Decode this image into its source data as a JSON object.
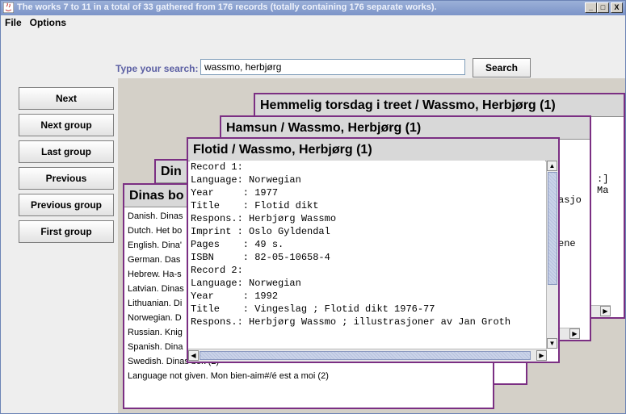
{
  "window": {
    "title": "The works 7 to 11 in a total of 33 gathered from 176 records (totally containing 176 separate works).",
    "minimize": "_",
    "maximize": "□",
    "close": "X"
  },
  "menu": {
    "file": "File",
    "options": "Options"
  },
  "search": {
    "label": "Type your search:",
    "value": "wassmo, herbjørg",
    "button": "Search"
  },
  "nav": {
    "next": "Next",
    "next_group": "Next group",
    "last_group": "Last group",
    "previous": "Previous",
    "previous_group": "Previous group",
    "first_group": "First group"
  },
  "cards": {
    "hemmelig": {
      "title": "Hemmelig torsdag i treet / Wassmo, Herbjørg (1)",
      "fragment": ":] Ma"
    },
    "hamsun": {
      "title": "Hamsun / Wassmo, Herbjørg (1)",
      "fragment1": "asjo",
      "fragment2": "ene"
    },
    "din": {
      "title": "Din"
    },
    "dinas": {
      "title": "Dinas bo",
      "items": [
        "Danish. Dinas",
        "Dutch. Het bo",
        "English. Dina'",
        "German. Das",
        "Hebrew. Ha-s",
        "Latvian. Dinas",
        "Lithuanian. Di",
        "Norwegian. D",
        "Russian. Knig",
        "Spanish. Dina",
        "Swedish. Dinas bok (2)",
        "Language not given. Mon bien-aim#/é est a moi (2)"
      ]
    },
    "flotid": {
      "title": "Flotid / Wassmo, Herbjørg (1)",
      "lines": [
        "Record 1:",
        "Language: Norwegian",
        "Year     : 1977",
        "Title    : Flotid dikt",
        "Respons.: Herbjørg Wassmo",
        "Imprint : Oslo Gyldendal",
        "Pages    : 49 s.",
        "ISBN     : 82-05-10658-4",
        "",
        "Record 2:",
        "Language: Norwegian",
        "Year     : 1992",
        "Title    : Vingeslag ; Flotid dikt 1976-77",
        "Respons.: Herbjørg Wassmo ; illustrasjoner av Jan Groth"
      ]
    }
  },
  "colors": {
    "card_border": "#7b2f83",
    "title_bar": "#7c94c8",
    "label": "#5b5fa3"
  }
}
